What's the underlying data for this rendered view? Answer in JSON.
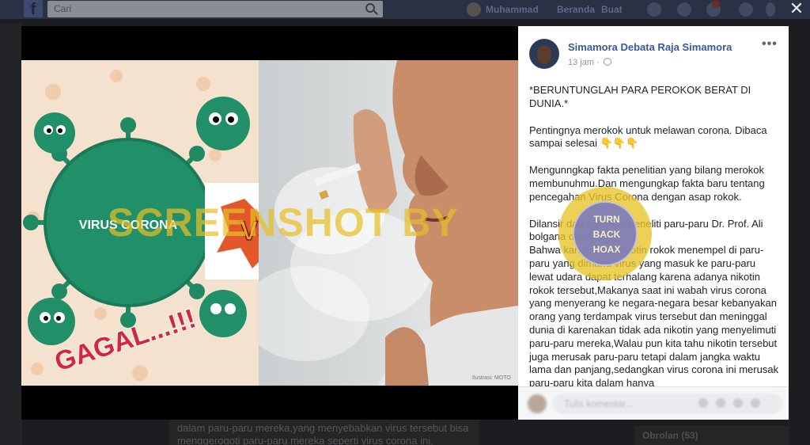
{
  "topbar": {
    "search_placeholder": "Cari",
    "user_name": "Muhammad",
    "home_label": "Beranda",
    "create_label": "Buat"
  },
  "post": {
    "author": "Simamora Debata Raja Simamora",
    "time": "13 jam",
    "paragraphs": [
      "*BERUNTUNGLAH PARA PEROKOK BERAT DI DUNIA.*",
      "Pentingnya merokok untuk melawan corona. Dibaca sampai selesai 👇👇👇",
      "Mengunngkap fakta penelitian yang bilang merokok membunuhmu.Dan mengungkap fakta baru tentang pencegahan Virus Corona dengan asap rokok.",
      "Dilansir dari halaman peneliti paru-paru Dr. Prof. Ali bolgana dari Mesir,",
      "Bahwa kandungan nikotin rokok menempel di paru-paru yang dimana virus yang masuk ke paru-paru lewat udara dapat terhalang karena adanya nikotin rokok tersebut,Makanya saat ini wabah virus corona yang menyerang ke negara-negara besar kebanyakan orang yang terdampak virus tersebut dan meninggal dunia di karenakan tidak ada nikotin yang menyelimuti paru-paru mereka,Walau pun kita tahu nikotin tersebut juga merusak paru-paru tetapi dalam jangka waktu lama dan panjang,sedangkan virus corona ini merusak paru-paru kita dalam hanya"
    ]
  },
  "comment_placeholder": "Tulis komentar...",
  "photo": {
    "virus_label": "VIRUS CORONA",
    "vs_label": "VS",
    "fail_label": "GAGAL...!!!",
    "credit": "Ilustrasi: MOTO"
  },
  "under_post_text": "dalam paru-paru mereka,yang menyebabkan virus tersebut bisa menggerogoti paru-paru mereka seperti virus corona ini.",
  "chat_label": "Obrolan (53)",
  "watermark": {
    "text": "SCREENSHOT BY",
    "seal_top": "TURN",
    "seal_mid": "BACK",
    "seal_bottom": "HOAX"
  }
}
